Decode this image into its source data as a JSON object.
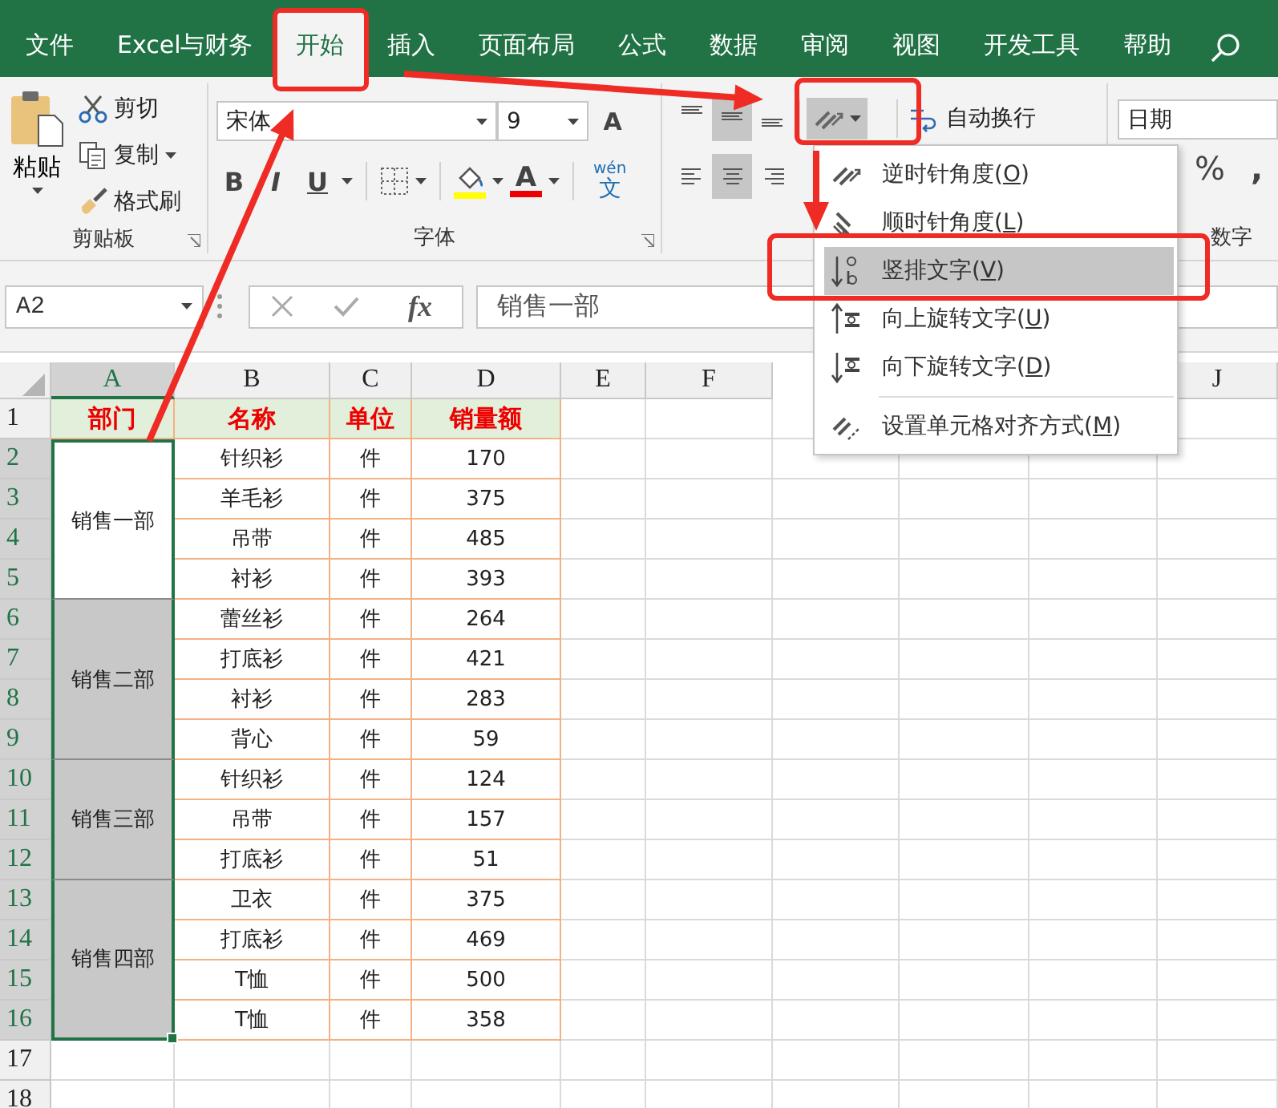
{
  "ribbon_tabs": [
    {
      "label": "文件",
      "selected": false,
      "highlighted": false
    },
    {
      "label": "Excel与财务",
      "selected": false,
      "highlighted": false
    },
    {
      "label": "开始",
      "selected": true,
      "highlighted": true
    },
    {
      "label": "插入",
      "selected": false,
      "highlighted": false
    },
    {
      "label": "页面布局",
      "selected": false,
      "highlighted": false
    },
    {
      "label": "公式",
      "selected": false,
      "highlighted": false
    },
    {
      "label": "数据",
      "selected": false,
      "highlighted": false
    },
    {
      "label": "审阅",
      "selected": false,
      "highlighted": false
    },
    {
      "label": "视图",
      "selected": false,
      "highlighted": false
    },
    {
      "label": "开发工具",
      "selected": false,
      "highlighted": false
    },
    {
      "label": "帮助",
      "selected": false,
      "highlighted": false
    }
  ],
  "clipboard": {
    "paste": "粘贴",
    "cut": "剪切",
    "copy": "复制",
    "format_painter": "格式刷",
    "label": "剪贴板"
  },
  "font": {
    "name": "宋体",
    "size": "9",
    "grow": "A",
    "bold": "B",
    "italic": "I",
    "underline": "U",
    "font_color": "A",
    "phonetic_top": "wén",
    "phonetic_bottom": "文",
    "label": "字体"
  },
  "alignment": {
    "top_row": [
      {
        "kind": "top",
        "selected": false
      },
      {
        "kind": "middle",
        "selected": true
      },
      {
        "kind": "bottom",
        "selected": false
      }
    ],
    "bottom_row": [
      {
        "kind": "left",
        "selected": false
      },
      {
        "kind": "center",
        "selected": true
      },
      {
        "kind": "right",
        "selected": false
      }
    ],
    "orientation": {
      "pressed": true,
      "highlighted": true
    },
    "wrap_text": "自动换行"
  },
  "number": {
    "format": "日期",
    "percent": "%",
    "comma": ",",
    "label": "数字"
  },
  "orientation_menu": [
    {
      "kind": "ccw",
      "before": "逆时针角度(",
      "key": "O",
      "after": ")",
      "selected": false,
      "highlighted": false
    },
    {
      "kind": "cw",
      "before": "顺时针角度(",
      "key": "L",
      "after": ")",
      "selected": false,
      "highlighted": false
    },
    {
      "kind": "vertical",
      "before": "竖排文字(",
      "key": "V",
      "after": ")",
      "selected": true,
      "highlighted": true
    },
    {
      "kind": "up",
      "before": "向上旋转文字(",
      "key": "U",
      "after": ")",
      "selected": false,
      "highlighted": false
    },
    {
      "kind": "down",
      "before": "向下旋转文字(",
      "key": "D",
      "after": ")",
      "selected": false,
      "highlighted": false
    },
    {
      "kind": "format",
      "before": "设置单元格对齐方式(",
      "key": "M",
      "after": ")",
      "selected": false,
      "highlighted": false
    }
  ],
  "formula_bar": {
    "name_box": "A2",
    "function": "fx",
    "formula": "销售一部"
  },
  "sheet": {
    "columns": [
      {
        "label": "A",
        "selected": true
      },
      {
        "label": "B",
        "selected": false
      },
      {
        "label": "C",
        "selected": false
      },
      {
        "label": "D",
        "selected": false
      },
      {
        "label": "E",
        "selected": false
      },
      {
        "label": "F",
        "selected": false
      },
      {
        "label": "J",
        "selected": false
      }
    ],
    "row_numbers": [
      {
        "label": "1",
        "selected": false
      },
      {
        "label": "2",
        "selected": true
      },
      {
        "label": "3",
        "selected": true
      },
      {
        "label": "4",
        "selected": true
      },
      {
        "label": "5",
        "selected": true
      },
      {
        "label": "6",
        "selected": true
      },
      {
        "label": "7",
        "selected": true
      },
      {
        "label": "8",
        "selected": true
      },
      {
        "label": "9",
        "selected": true
      },
      {
        "label": "10",
        "selected": true
      },
      {
        "label": "11",
        "selected": true
      },
      {
        "label": "12",
        "selected": true
      },
      {
        "label": "13",
        "selected": true
      },
      {
        "label": "14",
        "selected": true
      },
      {
        "label": "15",
        "selected": true
      },
      {
        "label": "16",
        "selected": true
      },
      {
        "label": "17",
        "selected": false
      },
      {
        "label": "18",
        "selected": false
      }
    ],
    "header": [
      "部门",
      "名称",
      "单位",
      "销量额"
    ],
    "groups": [
      {
        "department": "销售一部",
        "active": true,
        "items": [
          {
            "name": "针织衫",
            "unit": "件",
            "amount": "170"
          },
          {
            "name": "羊毛衫",
            "unit": "件",
            "amount": "375"
          },
          {
            "name": "吊带",
            "unit": "件",
            "amount": "485"
          },
          {
            "name": "衬衫",
            "unit": "件",
            "amount": "393"
          }
        ]
      },
      {
        "department": "销售二部",
        "active": false,
        "items": [
          {
            "name": "蕾丝衫",
            "unit": "件",
            "amount": "264"
          },
          {
            "name": "打底衫",
            "unit": "件",
            "amount": "421"
          },
          {
            "name": "衬衫",
            "unit": "件",
            "amount": "283"
          },
          {
            "name": "背心",
            "unit": "件",
            "amount": "59"
          }
        ]
      },
      {
        "department": "销售三部",
        "active": false,
        "items": [
          {
            "name": "针织衫",
            "unit": "件",
            "amount": "124"
          },
          {
            "name": "吊带",
            "unit": "件",
            "amount": "157"
          },
          {
            "name": "打底衫",
            "unit": "件",
            "amount": "51"
          }
        ]
      },
      {
        "department": "销售四部",
        "active": false,
        "items": [
          {
            "name": "卫衣",
            "unit": "件",
            "amount": "375"
          },
          {
            "name": "打底衫",
            "unit": "件",
            "amount": "469"
          },
          {
            "name": "T恤",
            "unit": "件",
            "amount": "500"
          },
          {
            "name": "T恤",
            "unit": "件",
            "amount": "358"
          }
        ]
      }
    ]
  },
  "annotations": [
    {
      "kind": "arrow"
    },
    {
      "kind": "arrow"
    },
    {
      "kind": "arrow"
    }
  ]
}
